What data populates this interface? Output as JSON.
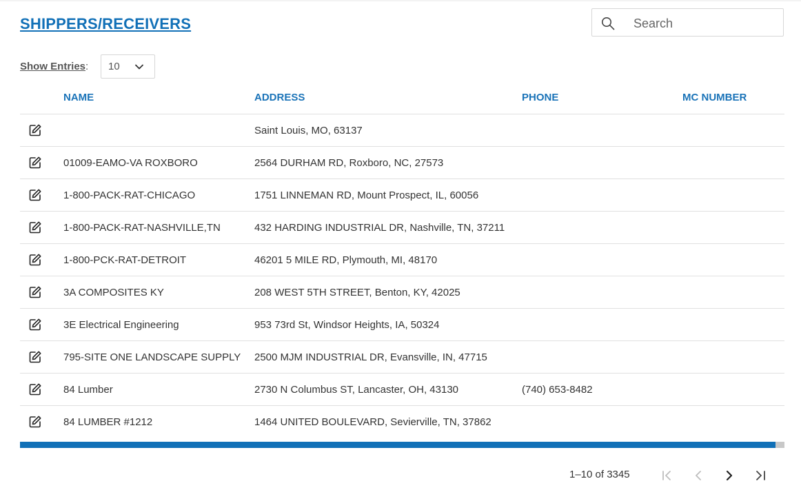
{
  "header": {
    "title": "SHIPPERS/RECEIVERS"
  },
  "search": {
    "placeholder": "Search",
    "value": ""
  },
  "entries": {
    "label": "Show Entries",
    "colon": ":",
    "value": "10"
  },
  "table": {
    "columns": [
      "NAME",
      "ADDRESS",
      "PHONE",
      "MC NUMBER"
    ],
    "rows": [
      {
        "name": "",
        "address": "Saint Louis, MO, 63137",
        "phone": "",
        "mc_number": ""
      },
      {
        "name": "01009-EAMO-VA ROXBORO",
        "address": "2564 DURHAM RD, Roxboro, NC, 27573",
        "phone": "",
        "mc_number": ""
      },
      {
        "name": "1-800-PACK-RAT-CHICAGO",
        "address": "1751 LINNEMAN RD, Mount Prospect, IL, 60056",
        "phone": "",
        "mc_number": ""
      },
      {
        "name": "1-800-PACK-RAT-NASHVILLE,TN",
        "address": "432 HARDING INDUSTRIAL DR, Nashville, TN, 37211",
        "phone": "",
        "mc_number": ""
      },
      {
        "name": "1-800-PCK-RAT-DETROIT",
        "address": "46201 5 MILE RD, Plymouth, MI, 48170",
        "phone": "",
        "mc_number": ""
      },
      {
        "name": "3A COMPOSITES KY",
        "address": "208 WEST 5TH STREET, Benton, KY, 42025",
        "phone": "",
        "mc_number": ""
      },
      {
        "name": "3E Electrical Engineering",
        "address": "953 73rd St, Windsor Heights, IA, 50324",
        "phone": "",
        "mc_number": ""
      },
      {
        "name": "795-SITE ONE LANDSCAPE SUPPLY",
        "address": "2500 MJM INDUSTRIAL DR, Evansville, IN, 47715",
        "phone": "",
        "mc_number": ""
      },
      {
        "name": "84 Lumber",
        "address": "2730 N Columbus ST, Lancaster, OH, 43130",
        "phone": "(740) 653-8482",
        "mc_number": ""
      },
      {
        "name": "84 LUMBER #1212",
        "address": "1464 UNITED BOULEVARD, Sevierville, TN, 37862",
        "phone": "",
        "mc_number": ""
      }
    ]
  },
  "pagination": {
    "info": "1–10 of 3345"
  },
  "icons": {
    "search": "search-icon",
    "select": "chevron-down-icon",
    "edit": "edit-icon",
    "first": "first-page-icon",
    "prev": "prev-page-icon",
    "next": "next-page-icon",
    "last": "last-page-icon"
  },
  "colors": {
    "accent": "#1170b7",
    "header_text": "#1a73b8",
    "disabled": "#bdbdbd"
  }
}
